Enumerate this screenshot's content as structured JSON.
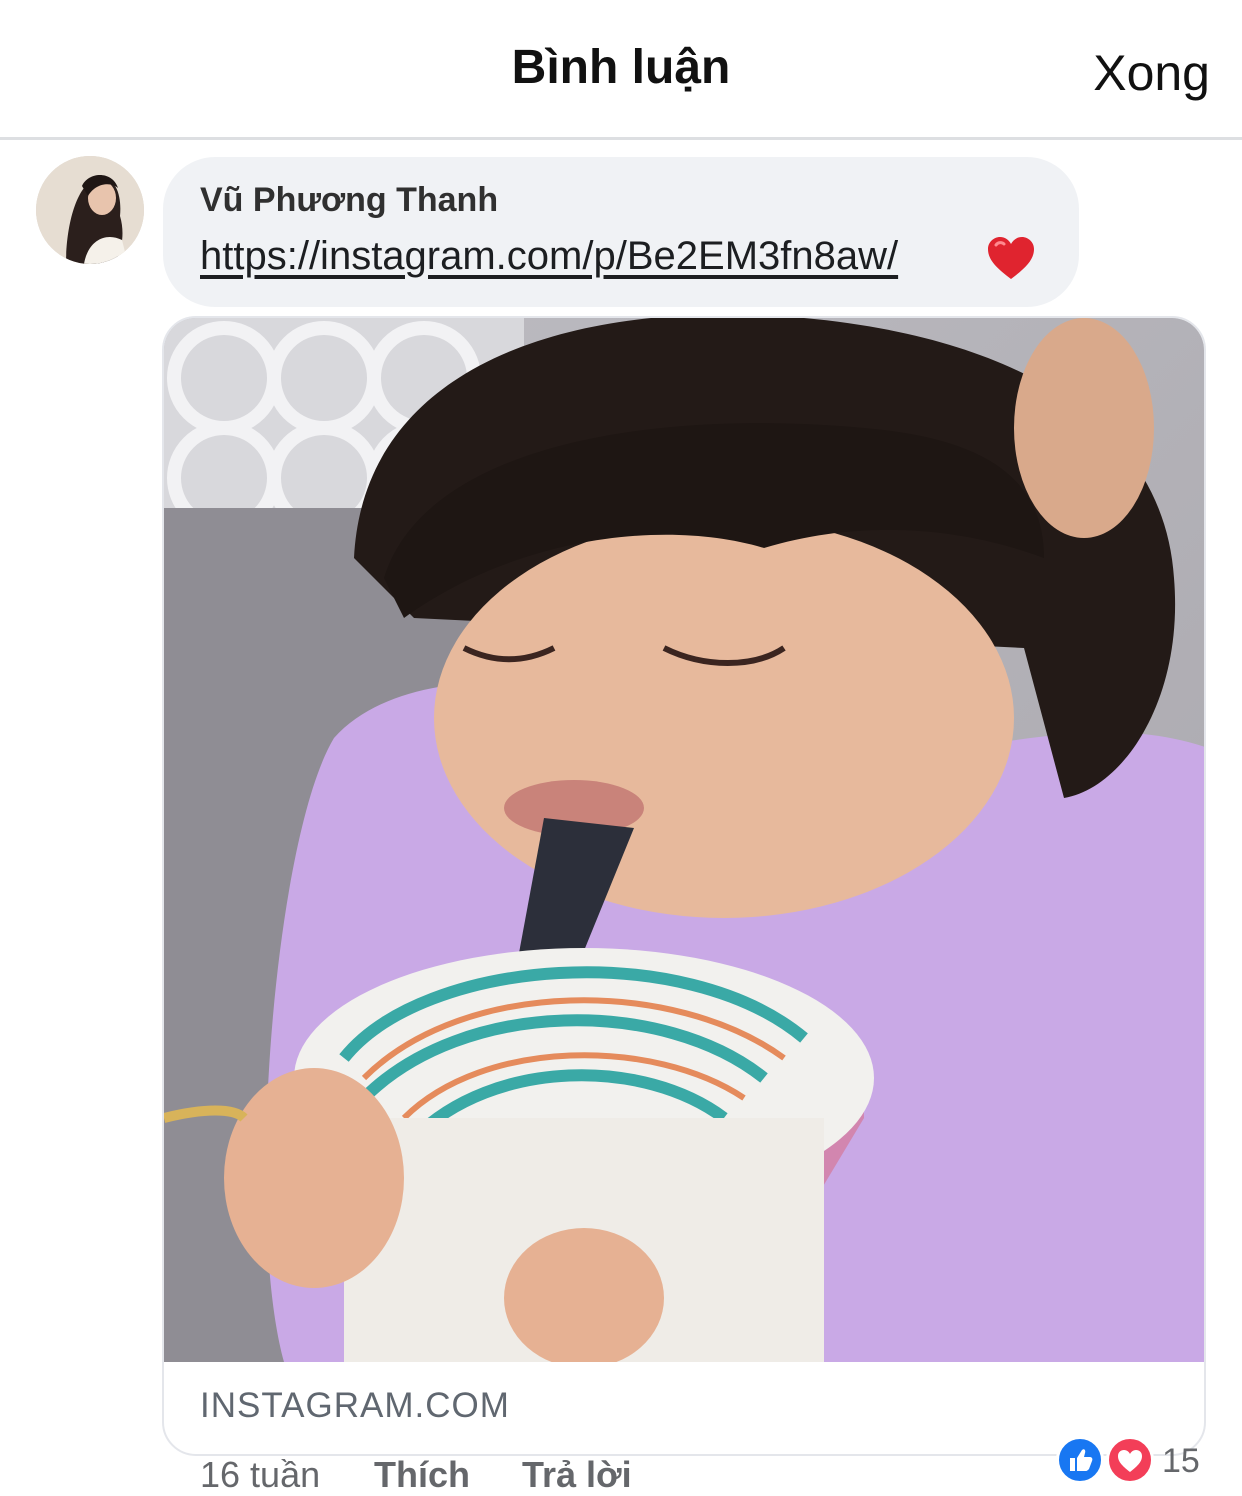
{
  "header": {
    "title": "Bình luận",
    "done_label": "Xong"
  },
  "comment": {
    "author": "Vũ Phương Thanh",
    "link_text": "https://instagram.com/p/Be2EM3fn8aw/",
    "emoji": "heart-emoji",
    "preview": {
      "image": "child-drinking-from-cup-photo",
      "domain": "INSTAGRAM.COM"
    },
    "meta": {
      "time": "16 tuần",
      "like_label": "Thích",
      "reply_label": "Trả lời"
    },
    "reactions": {
      "types": [
        "like-reaction",
        "love-reaction"
      ],
      "count": "15"
    }
  },
  "colors": {
    "like_blue": "#1877f2",
    "love_red": "#f33e58",
    "bubble_bg": "#f0f2f5",
    "muted_text": "#65676b"
  }
}
